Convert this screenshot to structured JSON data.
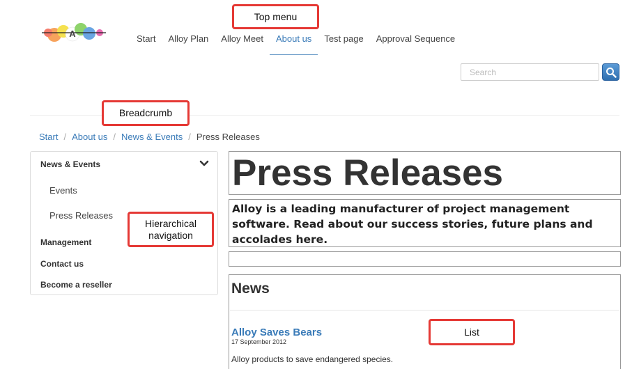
{
  "header": {
    "top_menu": [
      {
        "label": "Start",
        "active": false
      },
      {
        "label": "Alloy Plan",
        "active": false
      },
      {
        "label": "Alloy Meet",
        "active": false
      },
      {
        "label": "About us",
        "active": true
      },
      {
        "label": "Test page",
        "active": false
      },
      {
        "label": "Approval Sequence",
        "active": false
      }
    ],
    "search": {
      "placeholder": "Search"
    }
  },
  "breadcrumb": {
    "items": [
      "Start",
      "About us",
      "News & Events"
    ],
    "current": "Press Releases",
    "separator": "/"
  },
  "sidebar": {
    "section": "News & Events",
    "children": [
      "Events",
      "Press Releases"
    ],
    "items": [
      "Management",
      "Contact us",
      "Become a reseller"
    ]
  },
  "main": {
    "title": "Press Releases",
    "intro": "Alloy is a leading manufacturer of project management software. Read about our success stories, future plans and accolades here.",
    "news": {
      "heading": "News",
      "items": [
        {
          "title": "Alloy Saves Bears",
          "date": "17 September 2012",
          "description": "Alloy products to save endangered species."
        }
      ]
    }
  },
  "annotations": {
    "top_menu": "Top menu",
    "breadcrumb": "Breadcrumb",
    "hierarchical": "Hierarchical navigation",
    "list": "List"
  },
  "colors": {
    "link": "#3a7bb8",
    "callout_border": "#e53935",
    "search_button": "#2f6fb0"
  }
}
